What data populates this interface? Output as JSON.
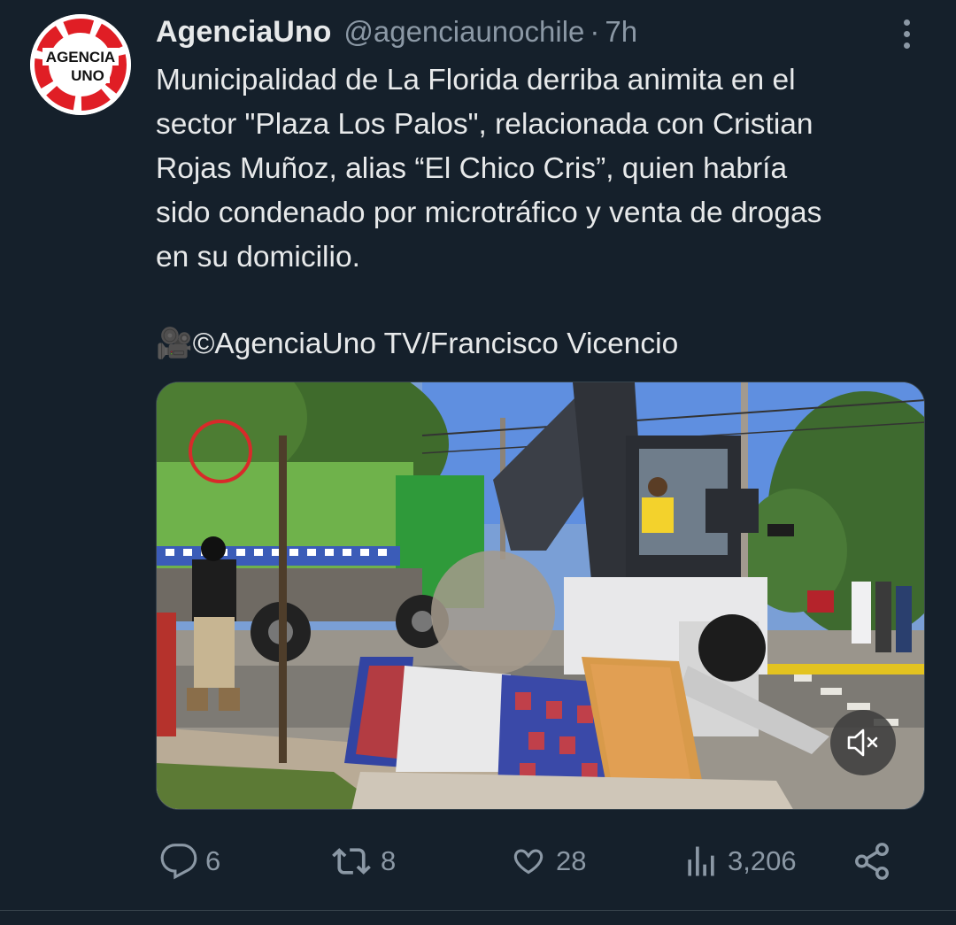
{
  "tweet": {
    "author": {
      "display_name": "AgenciaUno",
      "handle": "@agenciaunochile",
      "avatar_text_line1": "AGENCIA",
      "avatar_text_line2": "UNO"
    },
    "separator": "·",
    "timestamp": "7h",
    "text_lines": [
      "Municipalidad de La Florida derriba animita en el",
      "sector \"Plaza Los Palos\", relacionada con Cristian",
      "Rojas Muñoz, alias “El Chico Cris”, quien habría",
      "sido condenado por microtráfico y venta de drogas",
      "en su domicilio."
    ],
    "credit": "🎥©AgenciaUno TV/Francisco Vicencio",
    "media": {
      "kind": "video",
      "muted": true
    },
    "actions": {
      "replies": "6",
      "retweets": "8",
      "likes": "28",
      "views": "3,206"
    }
  },
  "colors": {
    "background": "#15202b",
    "text_primary": "#e7e9ea",
    "text_secondary": "#8b98a5",
    "border": "#38444d",
    "brand_red": "#e01e25"
  },
  "icons": [
    "more-options-icon",
    "reply-icon",
    "retweet-icon",
    "like-icon",
    "views-icon",
    "share-icon",
    "mute-icon"
  ]
}
